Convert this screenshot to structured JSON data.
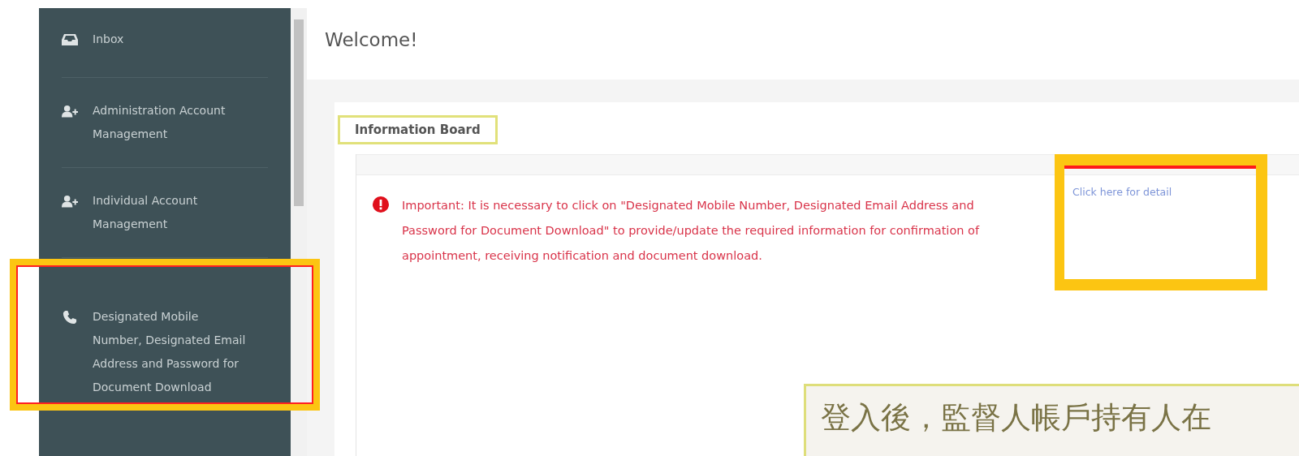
{
  "sidebar": {
    "items": [
      {
        "label": "Inbox",
        "kind": "inbox",
        "highlighted": false
      },
      {
        "label": "Administration Account Management",
        "kind": "account",
        "highlighted": false
      },
      {
        "label": "Individual Account Management",
        "kind": "account",
        "highlighted": false
      },
      {
        "label": "Designated Mobile Number, Designated Email Address and Password for Document Download",
        "kind": "contact",
        "highlighted": true
      }
    ]
  },
  "header": {
    "title": "Welcome!"
  },
  "board": {
    "title": "Information Board",
    "title_highlighted": true,
    "message": "Important: It is necessary to click on \"Designated Mobile Number, Designated Email Address and Password for Document Download\" to provide/update the required information for confirmation of appointment, receiving notification and document download.",
    "link": "Click here for detail",
    "link_highlighted": true
  },
  "callout": {
    "text": "登入後，監督人帳戶持有人在"
  }
}
